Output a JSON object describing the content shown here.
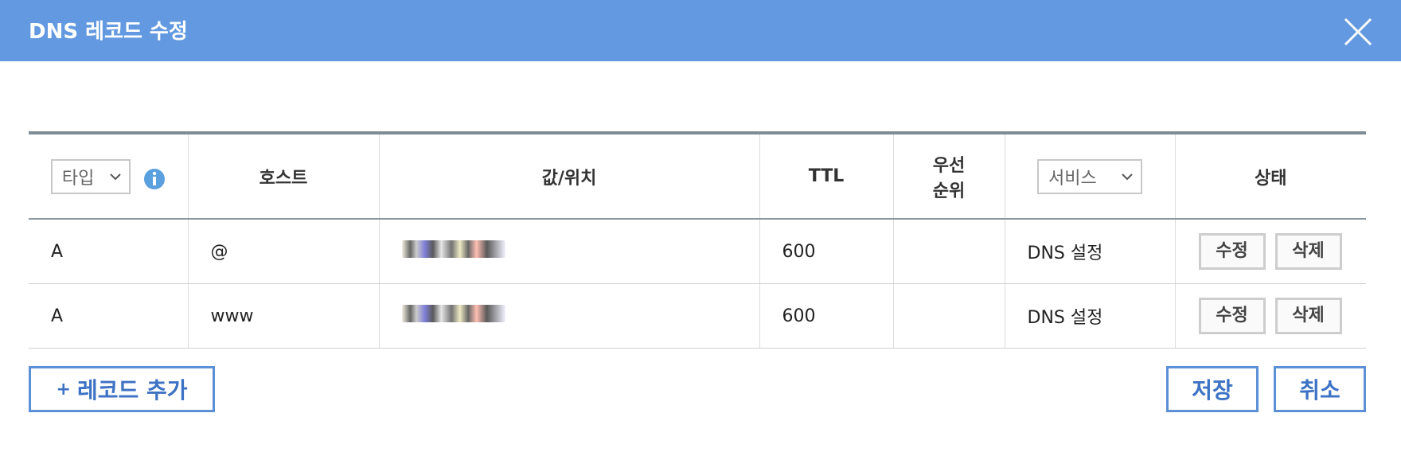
{
  "dialog": {
    "title": "DNS 레코드 수정"
  },
  "table": {
    "headers": {
      "type": "타입",
      "host": "호스트",
      "value": "값/위치",
      "ttl": "TTL",
      "priority_line1": "우선",
      "priority_line2": "순위",
      "service": "서비스",
      "status": "상태"
    },
    "rows": [
      {
        "type": "A",
        "host": "@",
        "ttl": "600",
        "priority": "",
        "service": "DNS 설정",
        "edit": "수정",
        "delete": "삭제"
      },
      {
        "type": "A",
        "host": "www",
        "ttl": "600",
        "priority": "",
        "service": "DNS 설정",
        "edit": "수정",
        "delete": "삭제"
      }
    ]
  },
  "footer": {
    "add_label": "레코드 추가",
    "add_icon": "+",
    "save": "저장",
    "cancel": "취소"
  },
  "colors": {
    "header": "#6399e0",
    "accent": "#3d72c4"
  },
  "icons": [
    "close-icon",
    "chevron-down-icon",
    "info-icon",
    "plus-icon"
  ]
}
